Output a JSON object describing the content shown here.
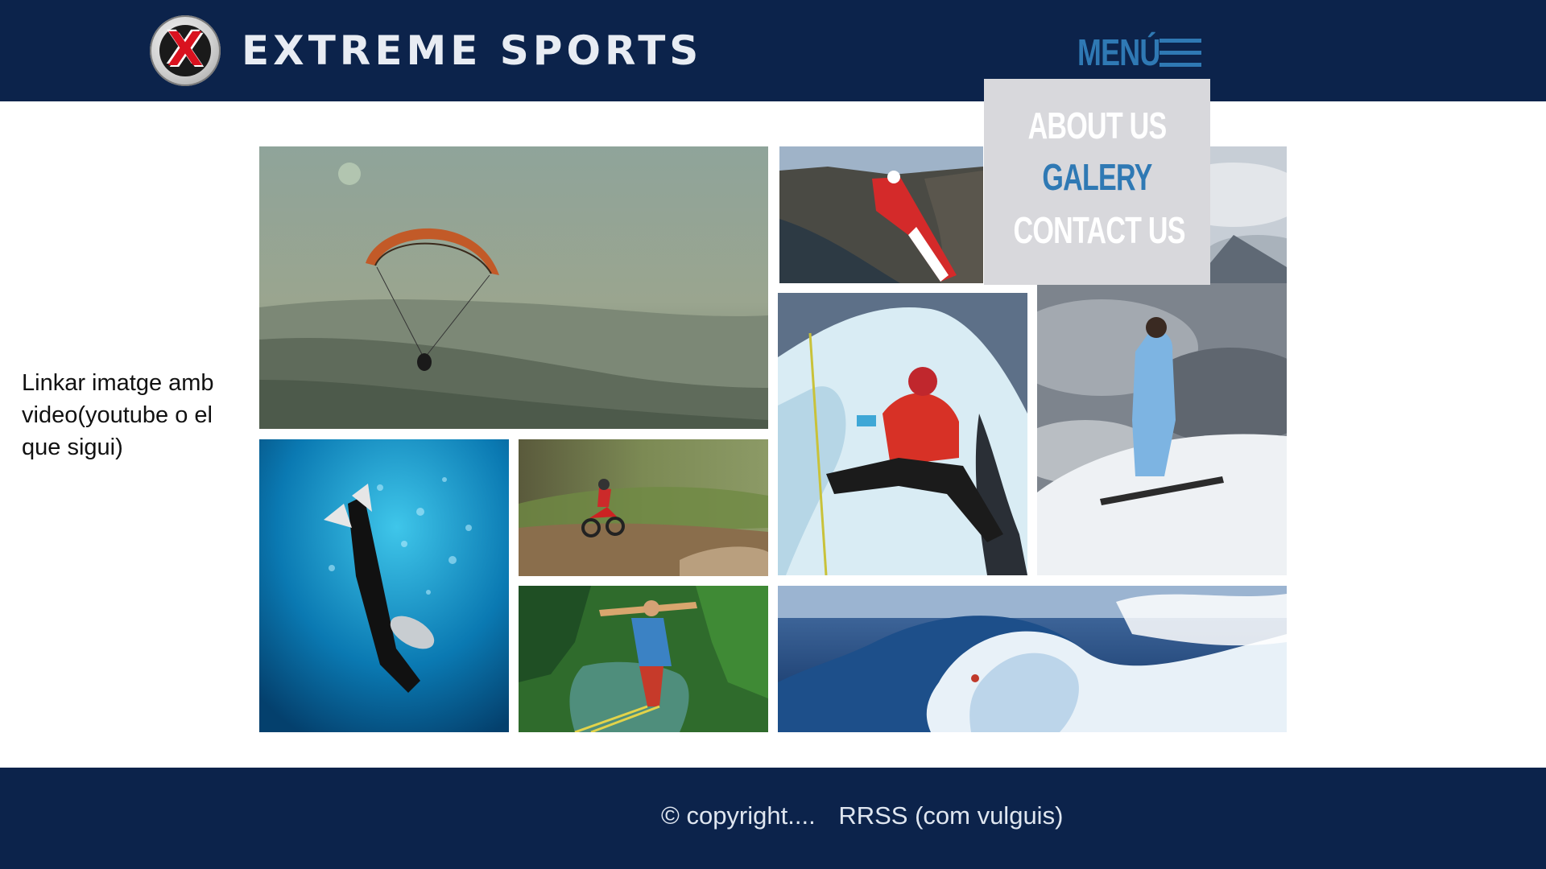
{
  "header": {
    "logo_letter": "X",
    "brand": "EXTREME SPORTS",
    "menu_label": "MENÚ"
  },
  "menu": {
    "items": [
      {
        "label": "ABOUT US",
        "active": false
      },
      {
        "label": "GALERY",
        "active": true
      },
      {
        "label": "CONTACT US",
        "active": false
      }
    ]
  },
  "side_note": "Linkar imatge amb video(youtube o el que sigui)",
  "gallery": {
    "photos": [
      {
        "subject": "paragliding"
      },
      {
        "subject": "wingsuit"
      },
      {
        "subject": "snow-mountains"
      },
      {
        "subject": "ice-climbing"
      },
      {
        "subject": "snowboarder"
      },
      {
        "subject": "scuba-diving"
      },
      {
        "subject": "motocross"
      },
      {
        "subject": "bungee-jumping"
      },
      {
        "subject": "surfing-wave"
      }
    ]
  },
  "footer": {
    "copyright": "© copyright....",
    "social": "RRSS (com vulguis)"
  },
  "colors": {
    "navy": "#0c234b",
    "accent_blue": "#2f79b4",
    "dropdown_bg": "#d8d8dc"
  }
}
